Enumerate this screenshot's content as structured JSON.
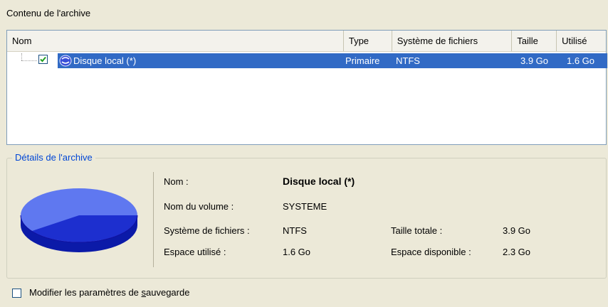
{
  "archive_contents": {
    "title": "Contenu de l'archive",
    "columns": [
      "Nom",
      "Type",
      "Système de fichiers",
      "Taille",
      "Utilisé"
    ],
    "rows": [
      {
        "checked": true,
        "icon": "disk-icon",
        "name": "Disque local (*)",
        "type": "Primaire",
        "filesystem": "NTFS",
        "size": "3.9 Go",
        "used": "1.6 Go"
      }
    ]
  },
  "details": {
    "title": "Détails de l'archive",
    "name_label": "Nom :",
    "name_value": "Disque local (*)",
    "volume_label": "Nom du volume :",
    "volume_value": "SYSTEME",
    "fs_label": "Système de fichiers :",
    "fs_value": "NTFS",
    "used_label": "Espace utilisé :",
    "used_value": "1.6 Go",
    "total_label": "Taille totale :",
    "total_value": "3.9 Go",
    "free_label": "Espace disponible :",
    "free_value": "2.3 Go",
    "usage_chart": {
      "used_fraction": 0.41,
      "used_color": "#1d2fcf",
      "free_color": "#5f78f0"
    }
  },
  "footer": {
    "modify_checked": false,
    "modify_label_before": "Modifier les paramètres de ",
    "modify_label_mnemonic": "s",
    "modify_label_after": "auvegarde"
  }
}
